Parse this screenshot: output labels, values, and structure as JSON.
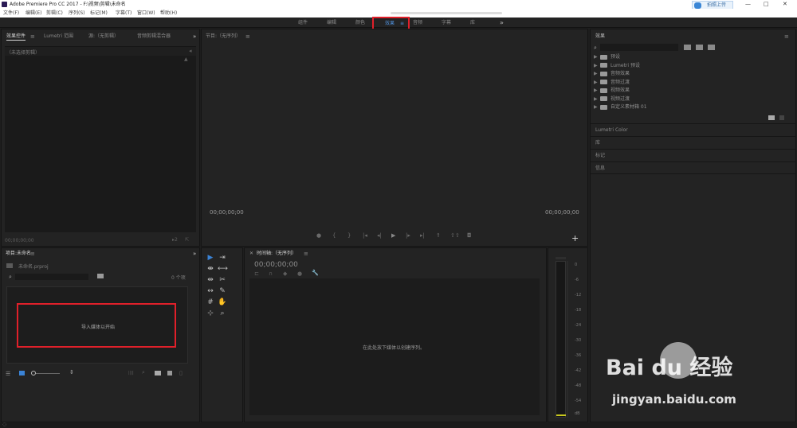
{
  "app_title": "Adobe Premiere Pro CC 2017 - F:\\视频\\剪辑\\未命名",
  "menu": [
    "文件(F)",
    "编辑(E)",
    "剪辑(C)",
    "序列(S)",
    "标记(M)",
    "字幕(T)",
    "窗口(W)",
    "帮助(H)"
  ],
  "capture_badge": "拍照上传",
  "window_controls": {
    "minimize": "—",
    "maximize": "□",
    "close": "✕"
  },
  "workspaces": [
    "组件",
    "编辑",
    "颜色",
    "效果",
    "音频",
    "字幕",
    "库"
  ],
  "active_workspace": "效果",
  "workspace_menu_icon": "≡",
  "more_glyph": "»",
  "source_panel": {
    "tabs": [
      "效果控件",
      "Lumetri 范围",
      "源:（无剪辑）",
      "音频剪辑混合器"
    ],
    "empty_label": "（未选择剪辑）",
    "timecode": "00;00;00;00"
  },
  "program_monitor": {
    "title": "节目:（无序列）",
    "timecode_left": "00;00;00;00",
    "timecode_right": "00;00;00;00",
    "add_glyph": "+"
  },
  "project_panel": {
    "title": "项目:未命名",
    "filename": "未命名.prproj",
    "item_count": "0 个项",
    "import_hint": "导入媒体以开始"
  },
  "timeline": {
    "title": "时间轴:（无序列）",
    "timecode": "00;00;00;00",
    "drop_hint": "在此处放下媒体以创建序列。"
  },
  "effects_panel": {
    "title": "效果",
    "items": [
      "预设",
      "Lumetri 预设",
      "音频效果",
      "音频过渡",
      "视频效果",
      "视频过渡",
      "自定义素材箱 01"
    ],
    "sections": [
      "Lumetri Color",
      "库",
      "标记",
      "信息"
    ]
  },
  "audio_meter": {
    "ticks": [
      "0",
      "-6",
      "-12",
      "-18",
      "-24",
      "-30",
      "-36",
      "-42",
      "-48",
      "-54",
      "dB"
    ]
  },
  "watermark": {
    "brand": "Bai du 经验",
    "url": "jingyan.baidu.com"
  }
}
